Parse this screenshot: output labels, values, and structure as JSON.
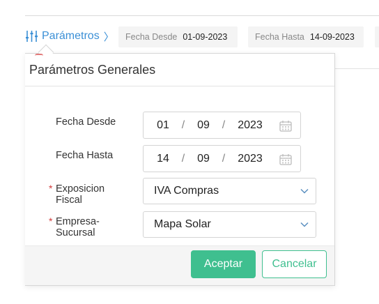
{
  "filter_bar": {
    "params_link_label": "Parámetros",
    "params_chevron": "〉",
    "chips": [
      {
        "label": "Fecha Desde",
        "value": "01-09-2023"
      },
      {
        "label": "Fecha Hasta",
        "value": "14-09-2023"
      }
    ]
  },
  "dialog": {
    "title": "Parámetros Generales",
    "fields": {
      "fecha_desde": {
        "label": "Fecha Desde",
        "day": "01",
        "month": "09",
        "year": "2023"
      },
      "fecha_hasta": {
        "label": "Fecha Hasta",
        "day": "14",
        "month": "09",
        "year": "2023"
      },
      "exposicion_fiscal": {
        "label_line1": "Exposicion",
        "label_line2": "Fiscal",
        "required_mark": "*",
        "value": "IVA Compras"
      },
      "empresa_sucursal": {
        "label_line1": "Empresa-",
        "label_line2": "Sucursal",
        "required_mark": "*",
        "value": "Mapa Solar"
      }
    },
    "date_separator": "/",
    "accept_label": "Aceptar",
    "cancel_label": "Cancelar"
  },
  "icons": [
    "sliders-icon",
    "chevron-right-icon",
    "calendar-icon",
    "chevron-down-icon"
  ],
  "colors": {
    "link_blue": "#3a8fd6",
    "accent_green": "#3fbf8f",
    "required_red": "#d23a3a"
  }
}
